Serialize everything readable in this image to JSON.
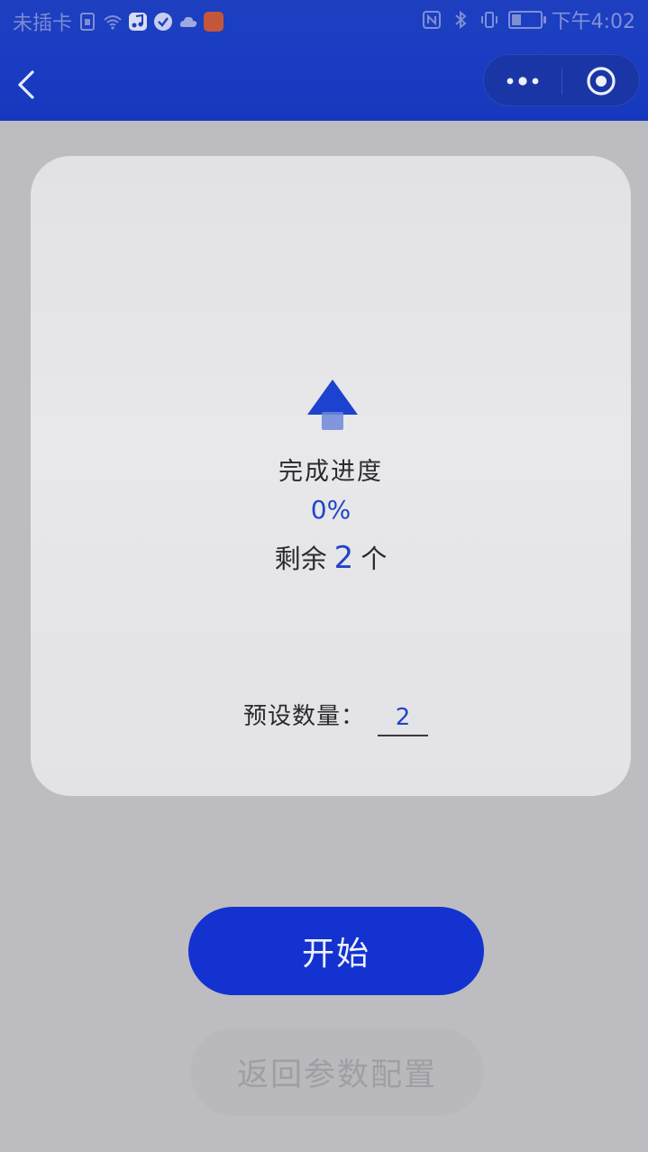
{
  "status_bar": {
    "carrier": "未插卡",
    "time": "下午4:02",
    "icons": [
      "sim-icon",
      "wifi-icon",
      "music-icon",
      "check-shield-icon",
      "cloud-icon",
      "app-icon",
      "nfc-icon",
      "bluetooth-icon",
      "vibrate-icon",
      "battery-icon"
    ]
  },
  "nav": {
    "back_icon": "chevron-left-icon",
    "more_icon": "more-dots-icon",
    "close_icon": "target-close-icon"
  },
  "progress": {
    "icon": "upload-arrow-icon",
    "title": "完成进度",
    "percent_text": "0%",
    "remaining_prefix": "剩余",
    "remaining_count": "2",
    "remaining_suffix": "个"
  },
  "preset": {
    "label": "预设数量：",
    "value": "2"
  },
  "buttons": {
    "start_label": "开始",
    "back_config_label": "返回参数配置"
  },
  "colors": {
    "brand_blue": "#1432cf",
    "header_blue": "#1a3cc2",
    "accent_text_blue": "#2244c6",
    "disabled_button": "#b9b8bd"
  }
}
